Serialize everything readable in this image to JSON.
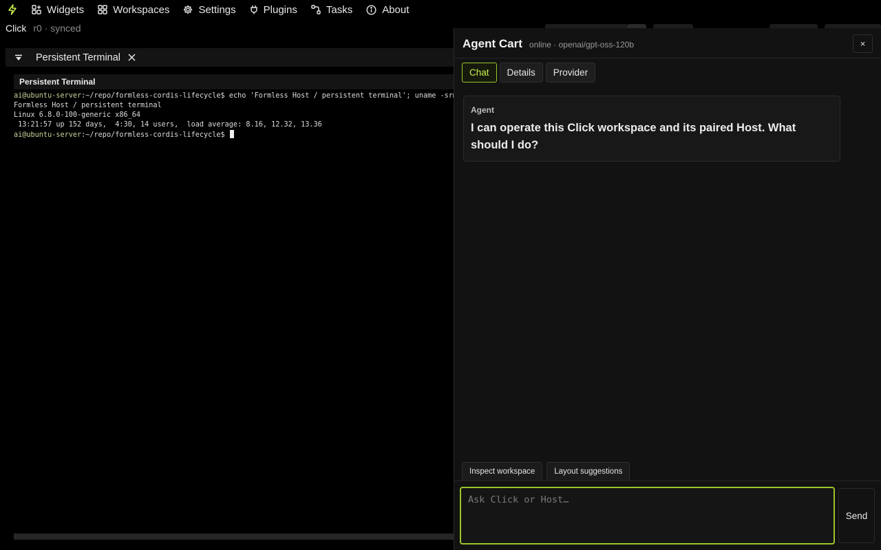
{
  "menubar": {
    "logo_icon": "lightning-icon",
    "items": [
      {
        "label": "Widgets",
        "icon": "widgets-icon"
      },
      {
        "label": "Workspaces",
        "icon": "grid-icon"
      },
      {
        "label": "Settings",
        "icon": "gear-icon"
      },
      {
        "label": "Plugins",
        "icon": "plug-icon"
      },
      {
        "label": "Tasks",
        "icon": "tasks-icon"
      },
      {
        "label": "About",
        "icon": "info-icon"
      }
    ]
  },
  "status": {
    "app": "Click",
    "sync": "r0 · synced"
  },
  "terminal": {
    "panel_title": "Persistent Terminal",
    "bar_title": "Persistent Terminal",
    "prompt_user": "ai@ubuntu-server",
    "prompt_path": ":~/repo/formless-cordis-lifecycle$ ",
    "command": "echo 'Formless Host / persistent terminal'; uname -srm;",
    "output": [
      "Formless Host / persistent terminal",
      "Linux 6.8.0-100-generic x86_64",
      " 13:21:57 up 152 days,  4:30, 14 users,  load average: 8.16, 12.32, 13.36"
    ]
  },
  "agent": {
    "title": "Agent Cart",
    "subtitle": "online · openai/gpt-oss-120b",
    "close_label": "×",
    "tabs": [
      {
        "label": "Chat",
        "active": true
      },
      {
        "label": "Details",
        "active": false
      },
      {
        "label": "Provider",
        "active": false
      }
    ],
    "message": {
      "role": "Agent",
      "text": "I can operate this Click workspace and its paired Host. What should I do?"
    },
    "suggestions": [
      "Inspect workspace",
      "Layout suggestions"
    ],
    "input_placeholder": "Ask Click or Host…",
    "input_value": "",
    "send_label": "Send"
  },
  "colors": {
    "accent": "#9bc62a",
    "accent_text": "#c9f04a",
    "background": "#000000",
    "panel": "#121212"
  }
}
